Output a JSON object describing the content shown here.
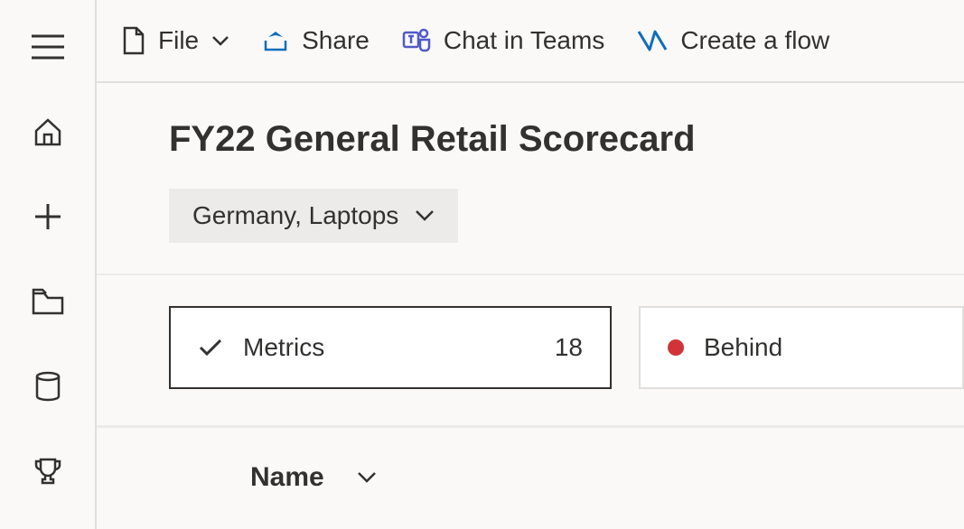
{
  "toolbar": {
    "file_label": "File",
    "share_label": "Share",
    "chat_label": "Chat in Teams",
    "flow_label": "Create a flow"
  },
  "page": {
    "title": "FY22 General Retail Scorecard",
    "filter_label": "Germany, Laptops"
  },
  "cards": {
    "metrics_label": "Metrics",
    "metrics_count": "18",
    "status_label": "Behind"
  },
  "table": {
    "col_name": "Name"
  }
}
